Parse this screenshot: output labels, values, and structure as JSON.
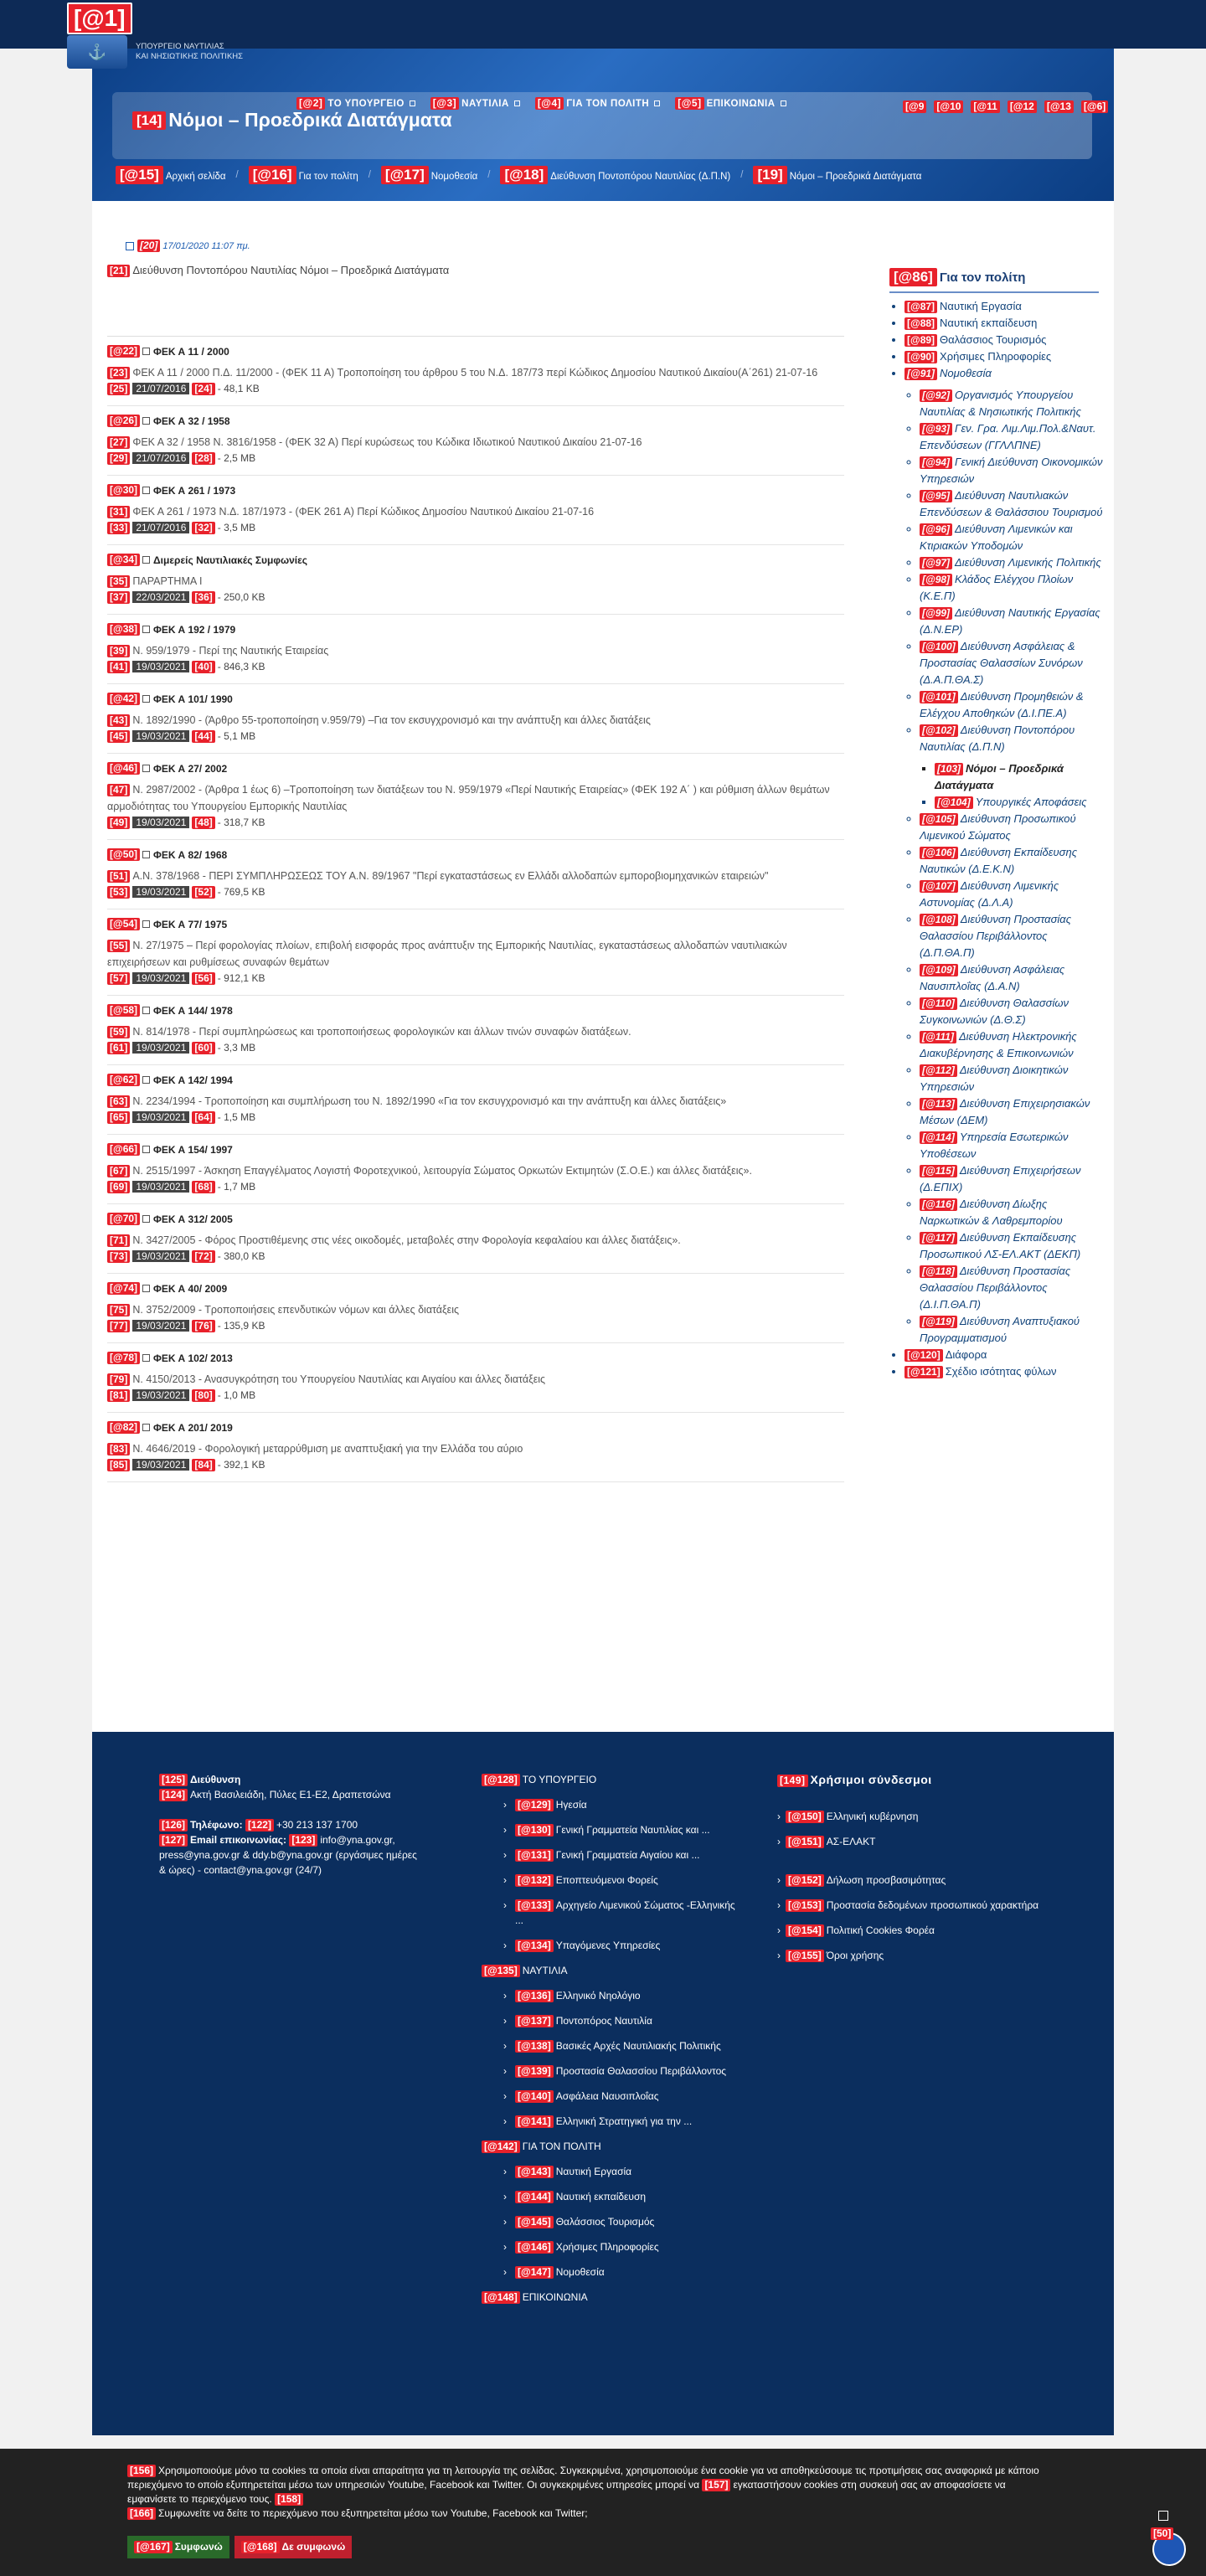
{
  "header": {
    "marker": "[@1]",
    "logo_line1": "ΥΠΟΥΡΓΕΙΟ ΝΑΥΤΙΛΙΑΣ",
    "logo_line2": "ΚΑΙ ΝΗΣΙΩΤΙΚΗΣ ΠΟΛΙΤΙΚΗΣ"
  },
  "nav": [
    {
      "m": "[@2]",
      "t": "ΤΟ ΥΠΟΥΡΓΕΙΟ"
    },
    {
      "m": "[@3]",
      "t": "ΝΑΥΤΙΛΙΑ"
    },
    {
      "m": "[@4]",
      "t": "ΓΙΑ ΤΟΝ ΠΟΛΙΤΗ"
    },
    {
      "m": "[@5]",
      "t": "ΕΠΙΚΟΙΝΩΝΙΑ"
    }
  ],
  "social": [
    "[@9",
    "[@10",
    "[@11",
    "[@12",
    "[@13",
    "[@6]"
  ],
  "title": {
    "m": "[14]",
    "t": "Νόμοι – Προεδρικά Διατάγματα"
  },
  "crumbs": [
    {
      "m": "[@15]",
      "t": "Αρχική σελίδα"
    },
    {
      "m": "[@16]",
      "t": "Για τον πολίτη"
    },
    {
      "m": "[@17]",
      "t": "Νομοθεσία"
    },
    {
      "m": "[@18]",
      "t": "Διεύθυνση Ποντοπόρου Ναυτιλίας (Δ.Π.Ν)"
    },
    {
      "m": "[19]",
      "t": "Νόμοι – Προεδρικά Διατάγματα"
    }
  ],
  "date": {
    "m": "[20]",
    "t": "17/01/2020 11:07 πμ."
  },
  "intro": {
    "m": "[21]",
    "t": "Διεύθυνση Ποντοπόρου Ναυτιλίας Νόμοι – Προεδρικά Διατάγματα"
  },
  "docs": [
    {
      "hm": "[@22]",
      "h": "ΦΕΚ Α 11 / 2000",
      "pm": "[23]",
      "p": "ΦΕΚ Α 11 / 2000 Π.Δ. 11/2000 - (ΦΕΚ 11 Α) Τροποποίηση του άρθρου 5 του Ν.Δ. 187/73 περί Κώδικος Δημοσίου Ναυτικού Δικαίου(Α΄261) 21-07-16",
      "dm": "[25]",
      "d": "21/07/2016",
      "sm": "[24]",
      "s": "- 48,1 KB"
    },
    {
      "hm": "[@26]",
      "h": "ΦΕΚ Α 32 / 1958",
      "pm": "[27]",
      "p": "ΦΕΚ Α 32 / 1958 Ν. 3816/1958 - (ΦΕΚ 32 Α) Περί κυρώσεως του Κώδικα Ιδιωτικού Ναυτικού Δικαίου 21-07-16",
      "dm": "[29]",
      "d": "21/07/2016",
      "sm": "[28]",
      "s": "- 2,5 MB"
    },
    {
      "hm": "[@30]",
      "h": "ΦΕΚ Α 261 / 1973",
      "pm": "[31]",
      "p": "ΦΕΚ Α 261 / 1973 Ν.Δ. 187/1973 - (ΦΕΚ 261 Α) Περί Κώδικος Δημοσίου Ναυτικού Δικαίου 21-07-16",
      "dm": "[33]",
      "d": "21/07/2016",
      "sm": "[32]",
      "s": "- 3,5 MB"
    },
    {
      "hm": "[@34]",
      "h": "Διμερείς Ναυτιλιακές Συμφωνίες",
      "pm": "[35]",
      "p": "ΠΑΡΑΡΤΗΜΑ Ι",
      "dm": "[37]",
      "d": "22/03/2021",
      "sm": "[36]",
      "s": "- 250,0 KB"
    },
    {
      "hm": "[@38]",
      "h": "ΦΕΚ Α 192 / 1979",
      "pm": "[39]",
      "p": "Ν. 959/1979 - Περί της Ναυτικής Εταιρείας",
      "dm": "[41]",
      "d": "19/03/2021",
      "sm": "[40]",
      "s": "- 846,3 KB"
    },
    {
      "hm": "[@42]",
      "h": "ΦΕΚ Α 101/ 1990",
      "pm": "[43]",
      "p": "Ν. 1892/1990 - (Άρθρο 55-τροποποίηση ν.959/79) –Για τον εκσυγχρονισμό και την ανάπτυξη και άλλες διατάξεις",
      "dm": "[45]",
      "d": "19/03/2021",
      "sm": "[44]",
      "s": "- 5,1 MB"
    },
    {
      "hm": "[@46]",
      "h": "ΦΕΚ Α 27/ 2002",
      "pm": "[47]",
      "p": "Ν. 2987/2002 - (Άρθρα 1 έως 6) –Τροποποίηση των διατάξεων του Ν. 959/1979 «Περί Ναυτικής Εταιρείας» (ΦΕΚ 192 Α΄ ) και ρύθμιση άλλων θεμάτων αρμοδιότητας του Υπουργείου Εμπορικής Ναυτιλίας",
      "dm": "[49]",
      "d": "19/03/2021",
      "sm": "[48]",
      "s": "- 318,7 KB"
    },
    {
      "hm": "[@50]",
      "h": "ΦΕΚ Α 82/ 1968",
      "pm": "[51]",
      "p": "Α.Ν. 378/1968 - ΠΕΡΙ ΣΥΜΠΛΗΡΩΣΕΩΣ ΤΟΥ Α.Ν. 89/1967 \"Περί εγκαταστάσεως εν Ελλάδι αλλοδαπών εμπορoβιομηχανικών εταιρειών\"",
      "dm": "[53]",
      "d": "19/03/2021",
      "sm": "[52]",
      "s": "- 769,5 KB"
    },
    {
      "hm": "[@54]",
      "h": "ΦΕΚ Α 77/ 1975",
      "pm": "[55]",
      "p": "Ν. 27/1975 – Περί φορολογίας πλοίων, επιβολή εισφοράς προς ανάπτυξιν της Εμπορικής Ναυτιλίας, εγκαταστάσεως αλλοδαπών ναυτιλιακών επιχειρήσεων και ρυθμίσεως συναφών θεμάτων",
      "dm": "[57]",
      "d": "19/03/2021",
      "sm": "[56]",
      "s": "- 912,1 KB"
    },
    {
      "hm": "[@58]",
      "h": "ΦΕΚ Α 144/ 1978",
      "pm": "[59]",
      "p": "Ν. 814/1978 - Περί συμπληρώσεως και τροποποιήσεως φορολογικών και άλλων τινών συναφών διατάξεων.",
      "dm": "[61]",
      "d": "19/03/2021",
      "sm": "[60]",
      "s": "- 3,3 MB"
    },
    {
      "hm": "[@62]",
      "h": "ΦΕΚ Α 142/ 1994",
      "pm": "[63]",
      "p": "Ν. 2234/1994 - Τροποποίηση και συμπλήρωση του Ν. 1892/1990 «Για τον εκσυγχρονισμό και την ανάπτυξη και άλλες διατάξεις»",
      "dm": "[65]",
      "d": "19/03/2021",
      "sm": "[64]",
      "s": "- 1,5 MB"
    },
    {
      "hm": "[@66]",
      "h": "ΦΕΚ Α 154/ 1997",
      "pm": "[67]",
      "p": "Ν. 2515/1997 - Άσκηση Επαγγέλματος Λογιστή Φοροτεχνικού, λειτουργία Σώματος Ορκωτών Εκτιμητών (Σ.Ο.Ε.) και άλλες διατάξεις».",
      "dm": "[69]",
      "d": "19/03/2021",
      "sm": "[68]",
      "s": "- 1,7 MB"
    },
    {
      "hm": "[@70]",
      "h": "ΦΕΚ Α 312/ 2005",
      "pm": "[71]",
      "p": "Ν. 3427/2005 - Φόρος Προστιθέμενης στις νέες οικοδομές, μεταβολές στην Φορολογία κεφαλαίου και άλλες διατάξεις».",
      "dm": "[73]",
      "d": "19/03/2021",
      "sm": "[72]",
      "s": "- 380,0 KB"
    },
    {
      "hm": "[@74]",
      "h": "ΦΕΚ Α 40/ 2009",
      "pm": "[75]",
      "p": "Ν. 3752/2009 - Τροποποιήσεις επενδυτικών νόμων και άλλες διατάξεις",
      "dm": "[77]",
      "d": "19/03/2021",
      "sm": "[76]",
      "s": "- 135,9 KB"
    },
    {
      "hm": "[@78]",
      "h": "ΦΕΚ Α 102/ 2013",
      "pm": "[79]",
      "p": "Ν. 4150/2013 - Ανασυγκρότηση του Υπουργείου Ναυτιλίας και Αιγαίου και άλλες διατάξεις",
      "dm": "[81]",
      "d": "19/03/2021",
      "sm": "[80]",
      "s": "- 1,0 MB"
    },
    {
      "hm": "[@82]",
      "h": "ΦΕΚ Α 201/ 2019",
      "pm": "[83]",
      "p": "Ν. 4646/2019 - Φορολογική μεταρρύθμιση με αναπτυξιακή για την Ελλάδα του αύριο",
      "dm": "[85]",
      "d": "19/03/2021",
      "sm": "[84]",
      "s": "- 392,1 KB"
    }
  ],
  "sidebar": {
    "m": "[@86]",
    "title": "Για τον πολίτη",
    "items": [
      {
        "m": "[@87]",
        "t": "Ναυτική Εργασία"
      },
      {
        "m": "[@88]",
        "t": "Ναυτική εκπαίδευση"
      },
      {
        "m": "[@89]",
        "t": "Θαλάσσιος Τουρισμός"
      },
      {
        "m": "[@90]",
        "t": "Χρήσιμες Πληροφορίες"
      },
      {
        "m": "[@91]",
        "t": "Νομοθεσία"
      }
    ],
    "sub": [
      {
        "m": "[@92]",
        "t": "Οργανισμός Υπουργείου Ναυτιλίας & Νησιωτικής Πολιτικής"
      },
      {
        "m": "[@93]",
        "t": "Γεν. Γρα. Λιμ.Λιμ.Πολ.&Ναυτ. Επενδύσεων (ΓΓΛΛΠΝΕ)"
      },
      {
        "m": "[@94]",
        "t": "Γενική Διεύθυνση Οικονομικών Υπηρεσιών"
      },
      {
        "m": "[@95]",
        "t": "Διεύθυνση Ναυτιλιακών Επενδύσεων & Θαλάσσιου Τουρισμού"
      },
      {
        "m": "[@96]",
        "t": "Διεύθυνση Λιμενικών και Κτιριακών Υποδομών"
      },
      {
        "m": "[@97]",
        "t": "Διεύθυνση Λιμενικής Πολιτικής"
      },
      {
        "m": "[@98]",
        "t": "Κλάδος Ελέγχου Πλοίων (Κ.Ε.Π)"
      },
      {
        "m": "[@99]",
        "t": "Διεύθυνση Ναυτικής Εργασίας (Δ.Ν.ΕΡ)"
      },
      {
        "m": "[@100]",
        "t": "Διεύθυνση Ασφάλειας & Προστασίας Θαλασσίων Συνόρων (Δ.Α.Π.ΘΑ.Σ)"
      },
      {
        "m": "[@101]",
        "t": "Διεύθυνση Προμηθειών & Ελέγχου Αποθηκών (Δ.Ι.ΠΕ.Α)"
      },
      {
        "m": "[@102]",
        "t": "Διεύθυνση Ποντοπόρου Ναυτιλίας (Δ.Π.Ν)"
      }
    ],
    "subsub": [
      {
        "m": "[103]",
        "t": "Νόμοι – Προεδρικά Διατάγματα"
      },
      {
        "m": "[@104]",
        "t": "Υπουργικές Αποφάσεις"
      }
    ],
    "sub2": [
      {
        "m": "[@105]",
        "t": "Διεύθυνση Προσωπικού Λιμενικού Σώματος"
      },
      {
        "m": "[@106]",
        "t": "Διεύθυνση Εκπαίδευσης Ναυτικών (Δ.Ε.Κ.Ν)"
      },
      {
        "m": "[@107]",
        "t": "Διεύθυνση Λιμενικής Αστυνομίας (Δ.Λ.Α)"
      },
      {
        "m": "[@108]",
        "t": "Διεύθυνση Προστασίας Θαλασσίου Περιβάλλοντος (Δ.Π.ΘΑ.Π)"
      },
      {
        "m": "[@109]",
        "t": "Διεύθυνση Ασφάλειας Ναυσιπλοΐας (Δ.Α.Ν)"
      },
      {
        "m": "[@110]",
        "t": "Διεύθυνση Θαλασσίων Συγκοινωνιών (Δ.Θ.Σ)"
      },
      {
        "m": "[@111]",
        "t": "Διεύθυνση Ηλεκτρονικής Διακυβέρνησης & Επικοινωνιών"
      },
      {
        "m": "[@112]",
        "t": "Διεύθυνση Διοικητικών Υπηρεσιών"
      },
      {
        "m": "[@113]",
        "t": "Διεύθυνση Επιχειρησιακών Μέσων (ΔΕΜ)"
      },
      {
        "m": "[@114]",
        "t": "Υπηρεσία Εσωτερικών Υποθέσεων"
      },
      {
        "m": "[@115]",
        "t": "Διεύθυνση Επιχειρήσεων (Δ.ΕΠΙΧ)"
      },
      {
        "m": "[@116]",
        "t": "Διεύθυνση Δίωξης Ναρκωτικών & Λαθρεμπορίου"
      },
      {
        "m": "[@117]",
        "t": "Διεύθυνση Εκπαίδευσης Προσωπικού ΛΣ-ΕΛ.ΑΚΤ (ΔΕΚΠ)"
      },
      {
        "m": "[@118]",
        "t": "Διεύθυνση Προστασίας Θαλασσίου Περιβάλλοντος (Δ.Ι.Π.ΘΑ.Π)"
      },
      {
        "m": "[@119]",
        "t": "Διεύθυνση Αναπτυξιακού Προγραμματισμού"
      }
    ],
    "tail": [
      {
        "m": "[@120]",
        "t": "Διάφορα"
      },
      {
        "m": "[@121]",
        "t": "Σχέδιο ισότητας φύλων"
      }
    ]
  },
  "footer": {
    "addr": {
      "m1": "[125]",
      "t1": "Διεύθυνση",
      "m2": "[124]",
      "t2": "Ακτή Βασιλειάδη, Πύλες Ε1-Ε2, Δραπετσώνα",
      "m3": "[126]",
      "t3": "Τηλέφωνο:",
      "m4": "[122]",
      "t4": "+30 213 137 1700",
      "m5": "[127]",
      "t5": "Email επικοινωνίας:",
      "m6": "[123]",
      "t6": "info@yna.gov.gr, press@yna.gov.gr & ddy.b@yna.gov.gr (εργάσιμες ημέρες & ώρες) - contact@yna.gov.gr (24/7)"
    },
    "col2": [
      {
        "m": "[@128]",
        "t": "ΤΟ ΥΠΟΥΡΓΕΙΟ",
        "s": false
      },
      {
        "m": "[@129]",
        "t": "Ηγεσία",
        "s": true
      },
      {
        "m": "[@130]",
        "t": "Γενική Γραμματεία Ναυτιλίας και ...",
        "s": true
      },
      {
        "m": "[@131]",
        "t": "Γενική Γραμματεία Αιγαίου και ...",
        "s": true
      },
      {
        "m": "[@132]",
        "t": "Εποπτευόμενοι Φορείς",
        "s": true
      },
      {
        "m": "[@133]",
        "t": "Αρχηγείο Λιμενικού Σώματος -Ελληνικής ...",
        "s": true
      },
      {
        "m": "[@134]",
        "t": "Υπαγόμενες Υπηρεσίες",
        "s": true
      },
      {
        "m": "[@135]",
        "t": "ΝΑΥΤΙΛΙΑ",
        "s": false
      },
      {
        "m": "[@136]",
        "t": "Ελληνικό Νηολόγιο",
        "s": true
      },
      {
        "m": "[@137]",
        "t": "Ποντοπόρος Ναυτιλία",
        "s": true
      },
      {
        "m": "[@138]",
        "t": "Βασικές Αρχές Ναυτιλιακής Πολιτικής",
        "s": true
      },
      {
        "m": "[@139]",
        "t": "Προστασία Θαλασσίου Περιβάλλοντος",
        "s": true
      },
      {
        "m": "[@140]",
        "t": "Ασφάλεια Ναυσιπλοΐας",
        "s": true
      },
      {
        "m": "[@141]",
        "t": "Ελληνική Στρατηγική για την ...",
        "s": true
      },
      {
        "m": "[@142]",
        "t": "ΓΙΑ ΤΟΝ ΠΟΛΙΤΗ",
        "s": false
      },
      {
        "m": "[@143]",
        "t": "Ναυτική Εργασία",
        "s": true
      },
      {
        "m": "[@144]",
        "t": "Ναυτική εκπαίδευση",
        "s": true
      },
      {
        "m": "[@145]",
        "t": "Θαλάσσιος Τουρισμός",
        "s": true
      },
      {
        "m": "[@146]",
        "t": "Χρήσιμες Πληροφορίες",
        "s": true
      },
      {
        "m": "[@147]",
        "t": "Νομοθεσία",
        "s": true
      },
      {
        "m": "[@148]",
        "t": "ΕΠΙΚΟΙΝΩΝΙΑ",
        "s": false
      }
    ],
    "col3_title": {
      "m": "[149]",
      "t": "Χρήσιμοι σύνδεσμοι"
    },
    "col3": [
      {
        "m": "[@150]",
        "t": "Ελληνική κυβέρνηση"
      },
      {
        "m": "[@151]",
        "t": "ΑΣ-ΕΛΑΚΤ"
      },
      {
        "m": "[@152]",
        "t": "Δήλωση προσβασιμότητας"
      },
      {
        "m": "[@153]",
        "t": "Προστασία δεδομένων προσωπικού χαρακτήρα"
      },
      {
        "m": "[@154]",
        "t": "Πολιτική Cookies Φορέα"
      },
      {
        "m": "[@155]",
        "t": "Όροι χρήσης"
      }
    ]
  },
  "cookie": {
    "m1": "[156]",
    "t1": "Χρησιμοποιούμε μόνο τα cookies τα οποία είναι απαραίτητα για τη λειτουργία της σελίδας. Συγκεκριμένα, χρησιμοποιούμε ένα cookie για να αποθηκεύσουμε τις προτιμήσεις σας αναφορικά με κάποιο περιεχόμενο το οποίο εξυπηρετείται μέσω των υπηρεσιών Youtube, Facebook και Twitter. Οι συγκεκριμένες υπηρεσίες μπορεί να",
    "m2": "[157]",
    "t2": "εγκαταστήσουν cookies στη συσκευή σας αν αποφασίσετε να εμφανίσετε το περιεχόμενο τους.",
    "m3": "[158]",
    "m4": "[166]",
    "t4": "Συμφωνείτε να δείτε το περιεχόμενο που εξυπηρετείται μέσω των Youtube, Facebook και Twitter;",
    "ok_m": "[@167]",
    "ok": "Συμφωνώ",
    "no_m": "[@168]",
    "no": "Δε συμφωνώ",
    "acc": "[50]"
  }
}
